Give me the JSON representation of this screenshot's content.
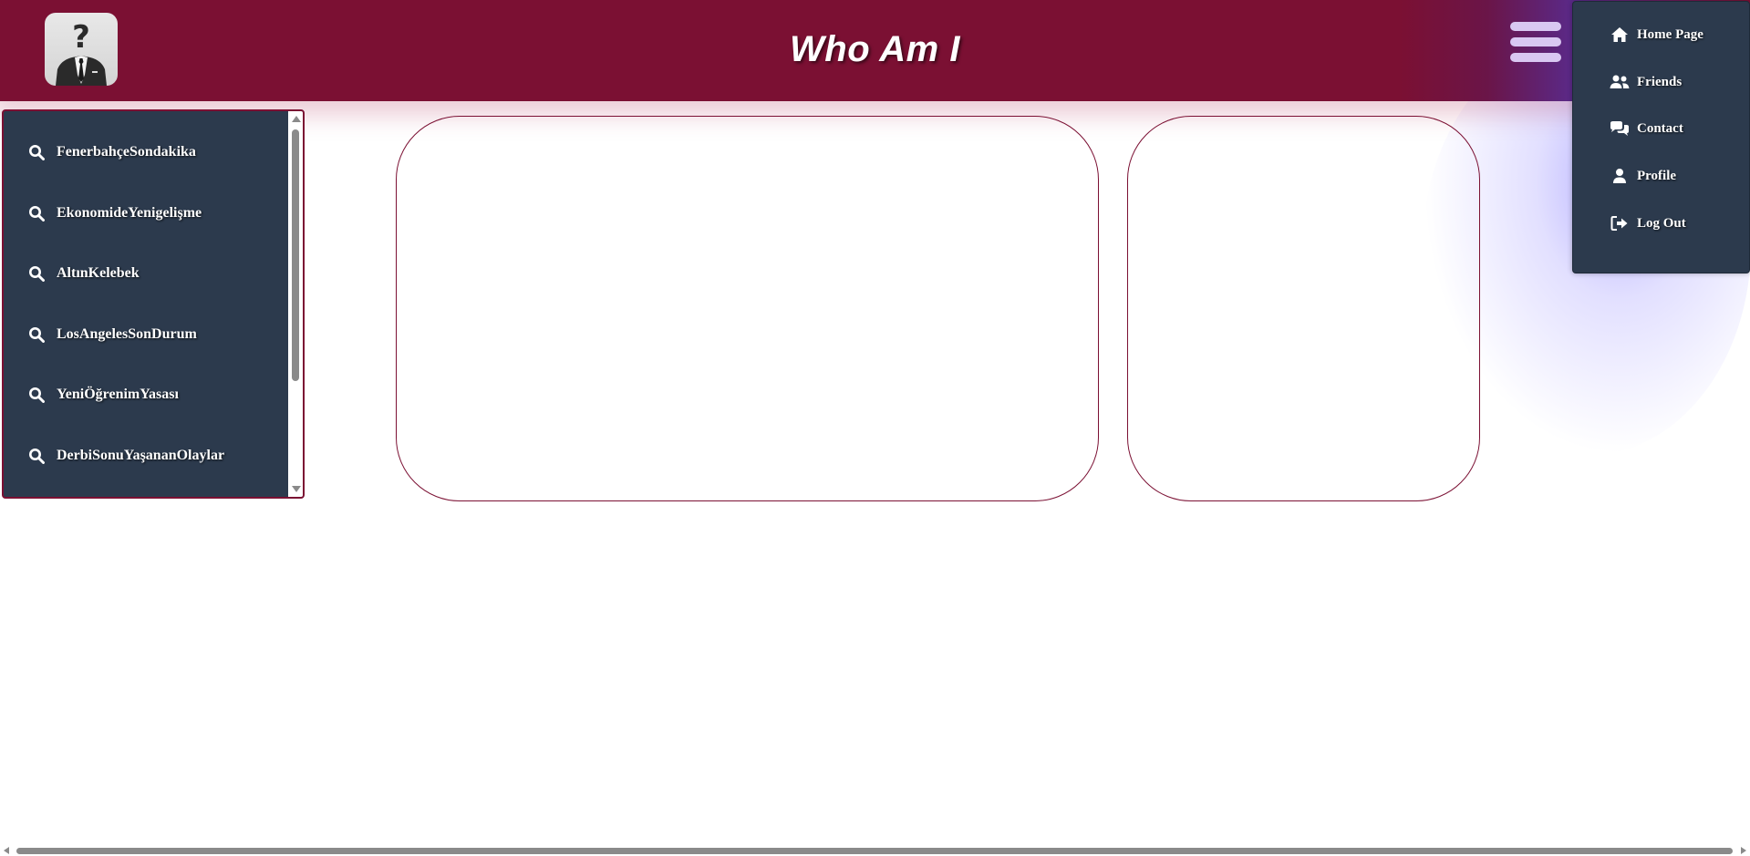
{
  "header": {
    "title": "Who Am I",
    "logo_icon": "faceless-person-question-mark-logo",
    "menu_icon": "hamburger-menu-icon"
  },
  "dropdown": {
    "items": [
      {
        "label": "Home Page",
        "icon": "home-icon"
      },
      {
        "label": "Friends",
        "icon": "friends-icon"
      },
      {
        "label": "Contact",
        "icon": "chat-bubbles-icon"
      },
      {
        "label": "Profile",
        "icon": "user-icon"
      },
      {
        "label": "Log Out",
        "icon": "logout-icon"
      }
    ]
  },
  "sidebar": {
    "items": [
      {
        "label": "FenerbahçeSondakika",
        "icon": "search-icon"
      },
      {
        "label": "EkonomideYenigelişme",
        "icon": "search-icon"
      },
      {
        "label": "AltınKelebek",
        "icon": "search-icon"
      },
      {
        "label": "LosAngelesSonDurum",
        "icon": "search-icon"
      },
      {
        "label": "YeniÖğrenimYasası",
        "icon": "search-icon"
      },
      {
        "label": "DerbiSonuYaşananOlaylar",
        "icon": "search-icon"
      }
    ]
  },
  "colors": {
    "header_bg": "#7b1033",
    "panel_bg": "#2c3a4d",
    "menu_lines": "#d9c8f2",
    "glow": "#7c6eff"
  }
}
